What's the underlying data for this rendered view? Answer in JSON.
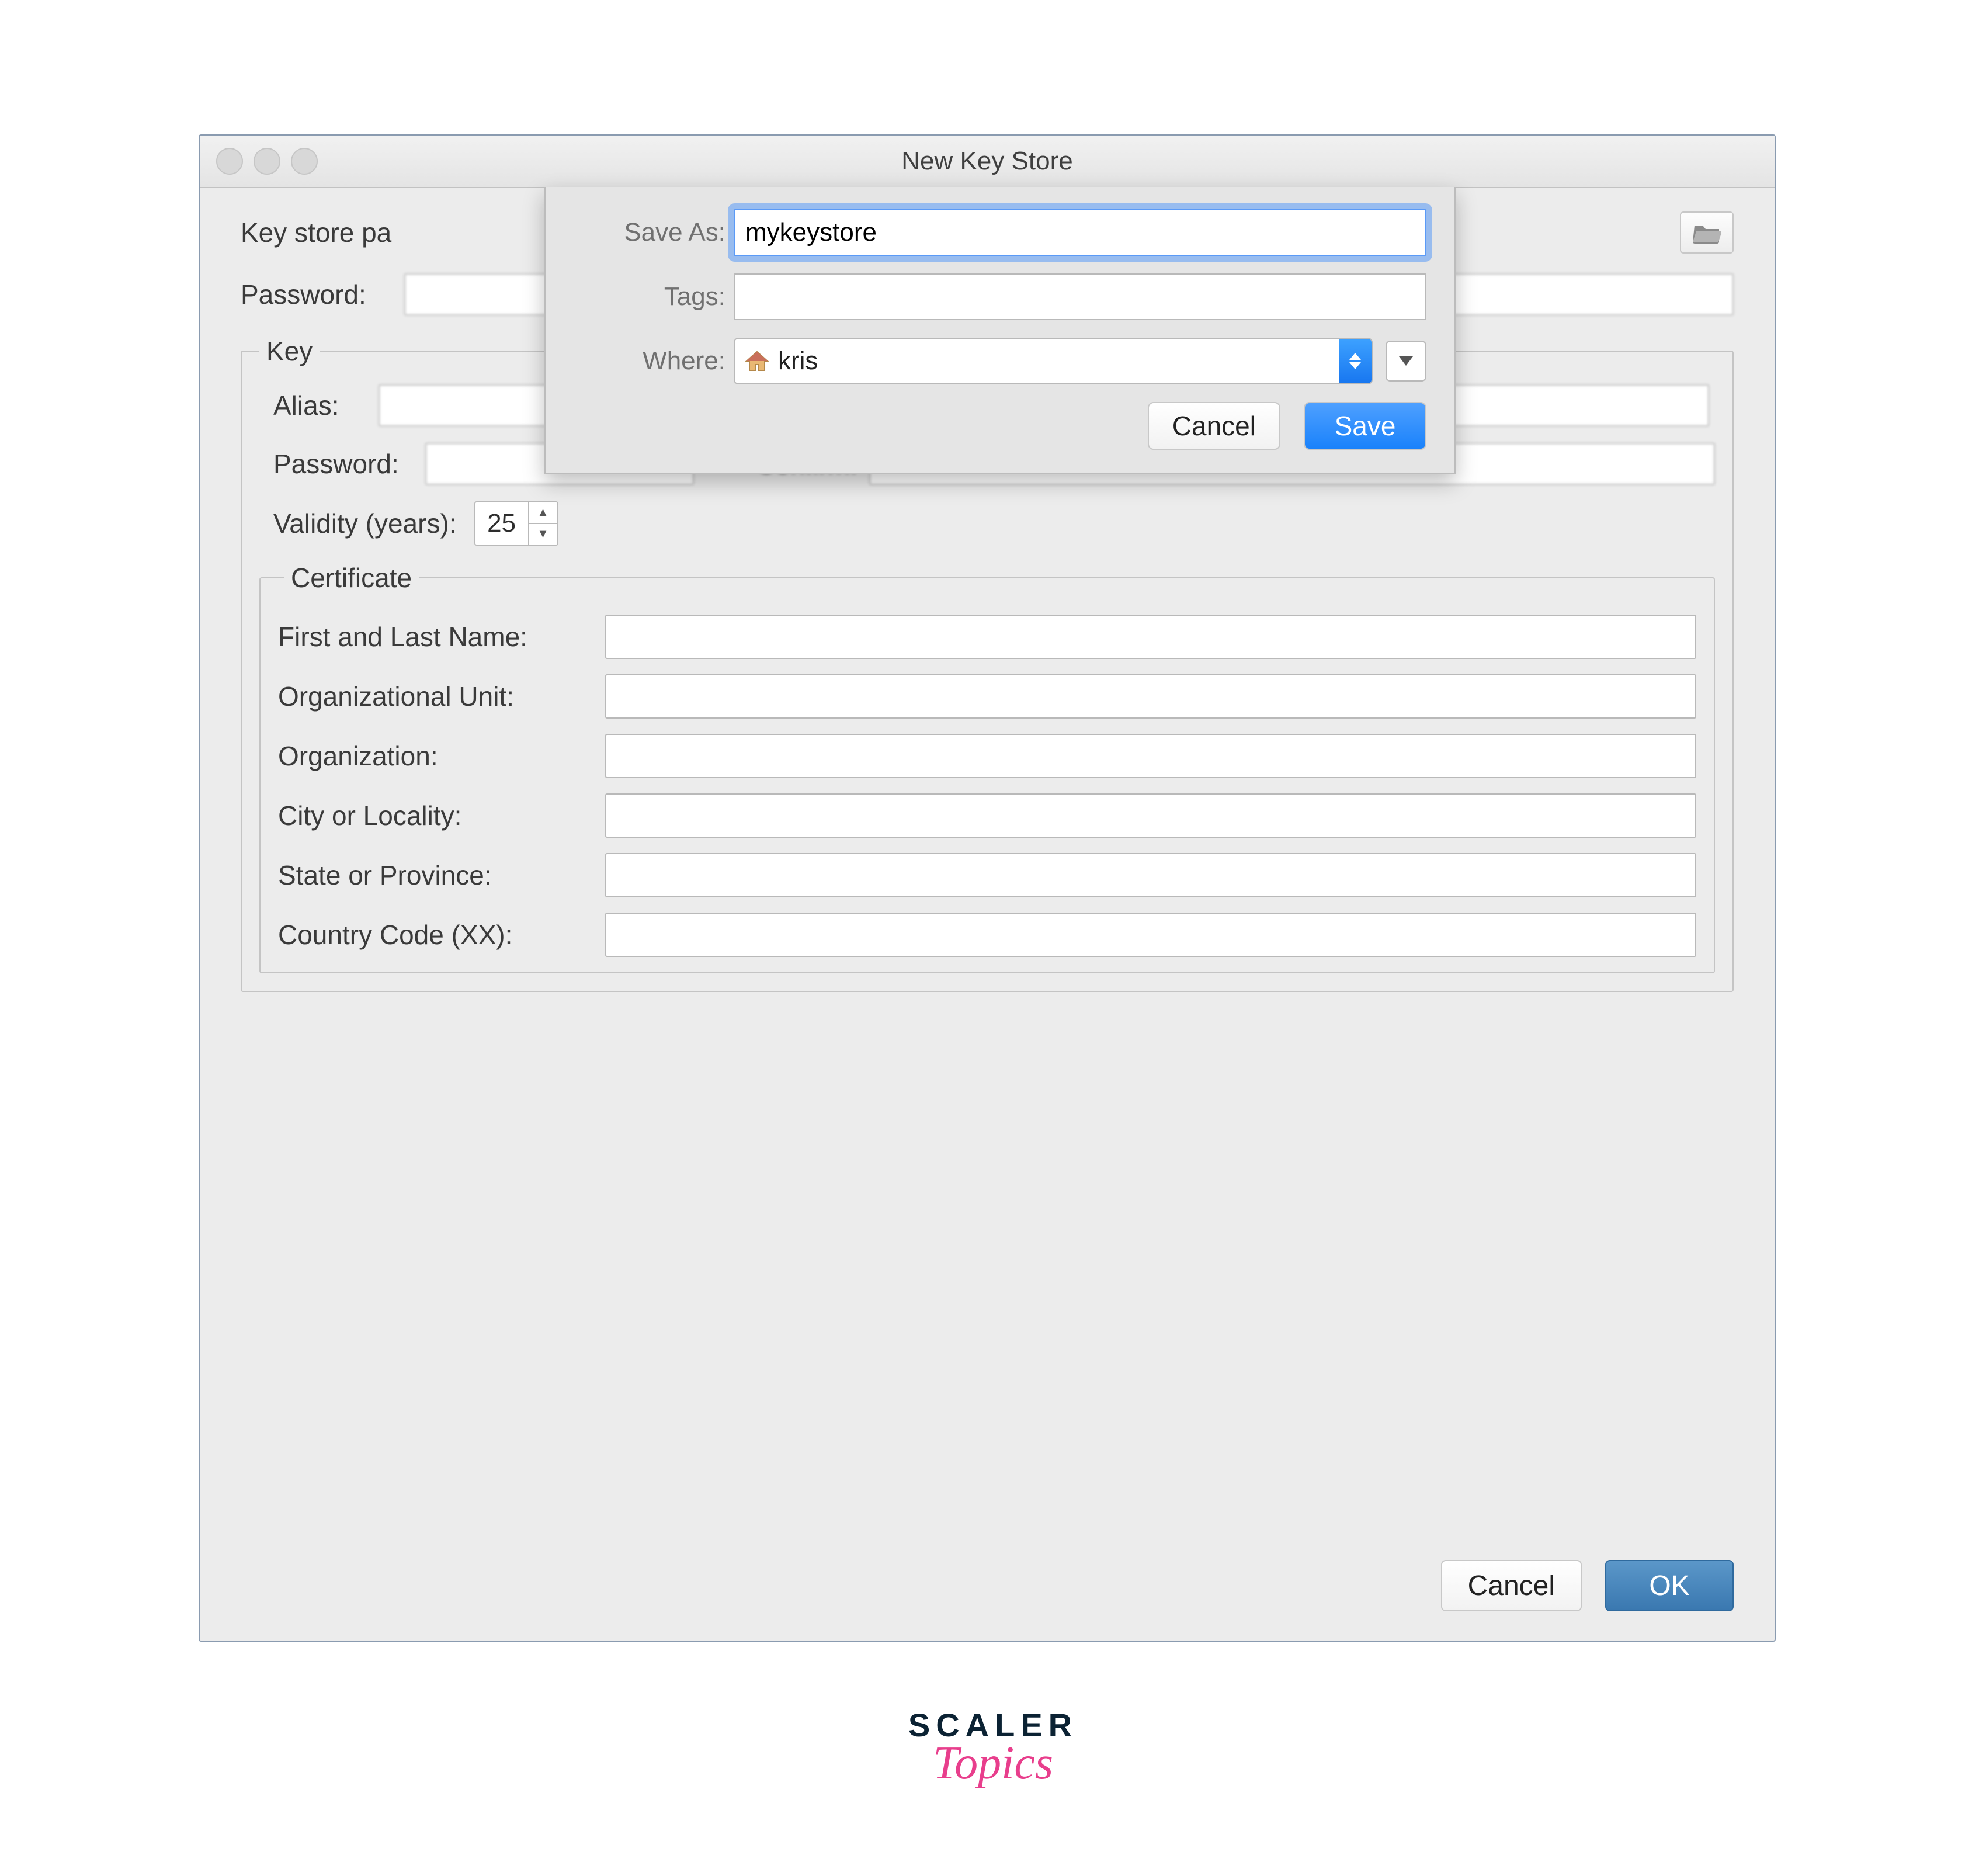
{
  "window": {
    "title": "New Key Store"
  },
  "fields": {
    "key_store_path_label_visible": "Key store pa",
    "password_label": "Password:",
    "key_legend": "Key",
    "alias_label": "Alias:",
    "key_password_label": "Password:",
    "key_confirm_label": "Confirm:",
    "validity_label": "Validity (years):",
    "validity_value": "25",
    "certificate_legend": "Certificate",
    "cert_first_last": "First and Last Name:",
    "cert_org_unit": "Organizational Unit:",
    "cert_org": "Organization:",
    "cert_city": "City or Locality:",
    "cert_state": "State or Province:",
    "cert_country": "Country Code (XX):"
  },
  "save_sheet": {
    "save_as_label": "Save As:",
    "save_as_value": "mykeystore",
    "tags_label": "Tags:",
    "tags_value": "",
    "where_label": "Where:",
    "where_value": "kris",
    "cancel_label": "Cancel",
    "save_label": "Save"
  },
  "footer": {
    "cancel_label": "Cancel",
    "ok_label": "OK"
  },
  "brand": {
    "line1": "SCALER",
    "line2": "Topics"
  }
}
